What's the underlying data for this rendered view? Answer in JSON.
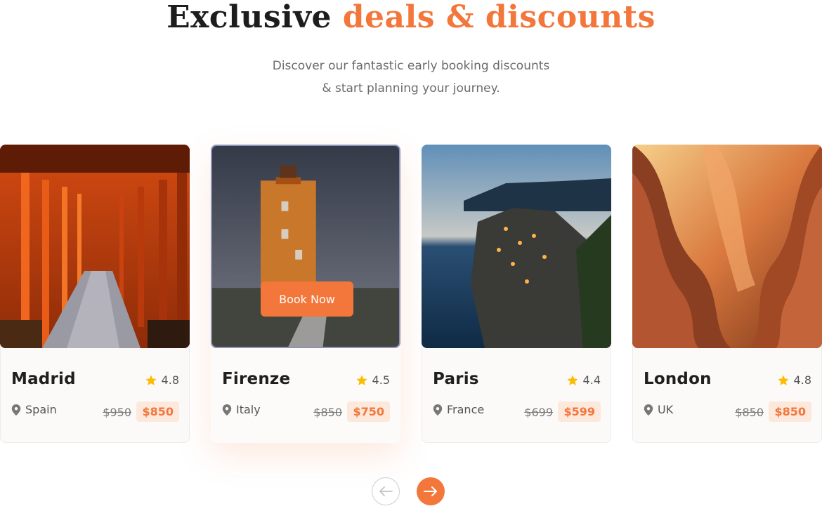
{
  "section": {
    "title_part1": "Exclusive",
    "title_part2": "deals & discounts",
    "subtitle_line1": "Discover our fantastic early booking discounts",
    "subtitle_line2": "& start planning your journey."
  },
  "colors": {
    "accent": "#f3763b",
    "price_badge_bg": "#fde8dc",
    "star": "#fbbc05"
  },
  "cards": [
    {
      "city": "Madrid",
      "country": "Spain",
      "rating": "4.8",
      "old_price": "$950",
      "new_price": "$850",
      "image": "torii-gates-path"
    },
    {
      "city": "Firenze",
      "country": "Italy",
      "rating": "4.5",
      "old_price": "$850",
      "new_price": "$750",
      "image": "orange-lighthouse",
      "book_label": "Book Now"
    },
    {
      "city": "Paris",
      "country": "France",
      "rating": "4.4",
      "old_price": "$699",
      "new_price": "$599",
      "image": "coastal-village-dusk"
    },
    {
      "city": "London",
      "country": "UK",
      "rating": "4.8",
      "old_price": "$850",
      "new_price": "$850",
      "image": "sandstone-canyon"
    }
  ],
  "carousel": {
    "prev_icon": "arrow-left-icon",
    "next_icon": "arrow-right-icon"
  }
}
